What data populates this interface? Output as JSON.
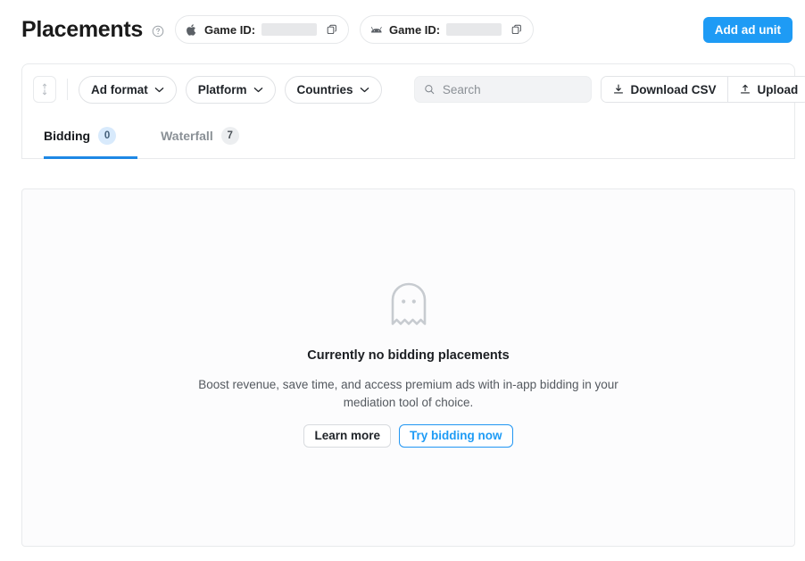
{
  "header": {
    "title": "Placements",
    "help_icon": "help-circle-icon",
    "platform_chips": [
      {
        "platform_icon": "apple-icon",
        "label": "Game ID:",
        "value": "",
        "value_redacted": true,
        "copy_icon": "copy-icon"
      },
      {
        "platform_icon": "android-icon",
        "label": "Game ID:",
        "value": "",
        "value_redacted": true,
        "copy_icon": "copy-icon"
      }
    ],
    "add_ad_unit_label": "Add ad unit"
  },
  "toolbar": {
    "sort_icon": "sort-vertical-icon",
    "filters": [
      {
        "label": "Ad format",
        "icon": "chevron-down-icon"
      },
      {
        "label": "Platform",
        "icon": "chevron-down-icon"
      },
      {
        "label": "Countries",
        "icon": "chevron-down-icon"
      }
    ],
    "search": {
      "icon": "search-icon",
      "placeholder": "Search",
      "value": ""
    },
    "download_csv_label": "Download CSV",
    "download_icon": "download-icon",
    "upload_label": "Upload",
    "upload_icon": "upload-icon"
  },
  "tabs": [
    {
      "label": "Bidding",
      "count": "0",
      "active": true
    },
    {
      "label": "Waterfall",
      "count": "7",
      "active": false
    }
  ],
  "empty_state": {
    "icon": "ghost-icon",
    "title": "Currently no bidding placements",
    "description": "Boost revenue, save time, and access premium ads with in-app bidding in your mediation tool of choice.",
    "learn_more_label": "Learn more",
    "try_bidding_label": "Try bidding now"
  },
  "colors": {
    "accent_blue": "#1e9bf5",
    "tab_underline": "#1e88e5",
    "active_badge_bg": "#d8eafc",
    "inactive_badge_bg": "#eceef0",
    "border": "#e8eaec",
    "card_bg": "#fcfcfd"
  }
}
